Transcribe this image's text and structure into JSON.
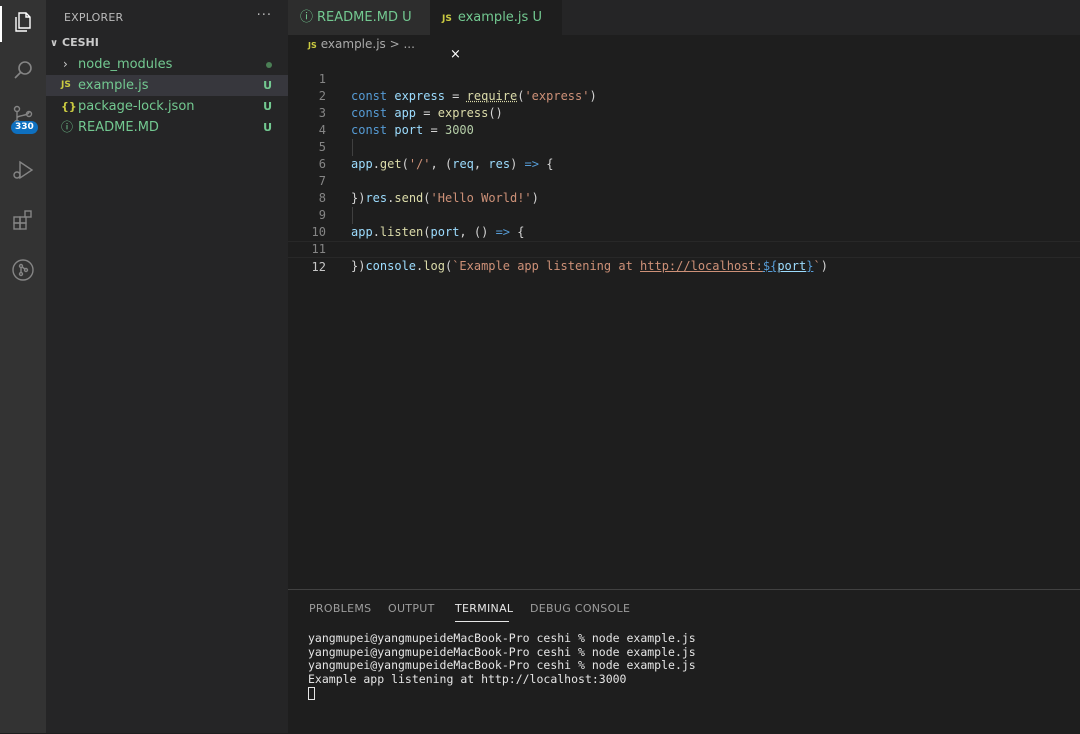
{
  "activity_bar": {
    "icons": [
      "files-icon",
      "search-icon",
      "source-control-icon",
      "run-debug-icon",
      "extensions-icon",
      "git-graph-icon"
    ],
    "scm_badge": "330"
  },
  "explorer": {
    "title": "EXPLORER",
    "more": "···",
    "folder": "CESHI",
    "items": [
      {
        "label": "node_modules",
        "icon": "chevron-right",
        "status": "",
        "color": "#73c991"
      },
      {
        "label": "example.js",
        "icon": "JS",
        "status": "U",
        "color": "#73c991"
      },
      {
        "label": "package-lock.json",
        "icon": "{}",
        "status": "U",
        "color": "#73c991"
      },
      {
        "label": "README.MD",
        "icon": "ⓘ",
        "status": "U",
        "color": "#73c991"
      }
    ]
  },
  "tabs": [
    {
      "icon": "ⓘ",
      "label": "README.MD",
      "status": "U"
    },
    {
      "icon": "JS",
      "label": "example.js",
      "status": "U",
      "close": "×"
    }
  ],
  "breadcrumb": {
    "icon": "JS",
    "file": "example.js",
    "rest": " > ..."
  },
  "editor": {
    "line_numbers": [
      "1",
      "2",
      "3",
      "4",
      "5",
      "6",
      "7",
      "8",
      "9",
      "10",
      "11",
      "12"
    ]
  },
  "panel": {
    "tabs": [
      "PROBLEMS",
      "OUTPUT",
      "TERMINAL",
      "DEBUG CONSOLE"
    ],
    "active_tab": "TERMINAL",
    "terminal_lines": [
      "yangmupei@yangmupeideMacBook-Pro ceshi % node example.js",
      "yangmupei@yangmupeideMacBook-Pro ceshi % node example.js",
      "yangmupei@yangmupeideMacBook-Pro ceshi % node example.js",
      "Example app listening at http://localhost:3000"
    ]
  },
  "colors": {
    "accent": "#0e70c0",
    "untracked": "#73c991",
    "js_icon": "#cbcb41"
  }
}
